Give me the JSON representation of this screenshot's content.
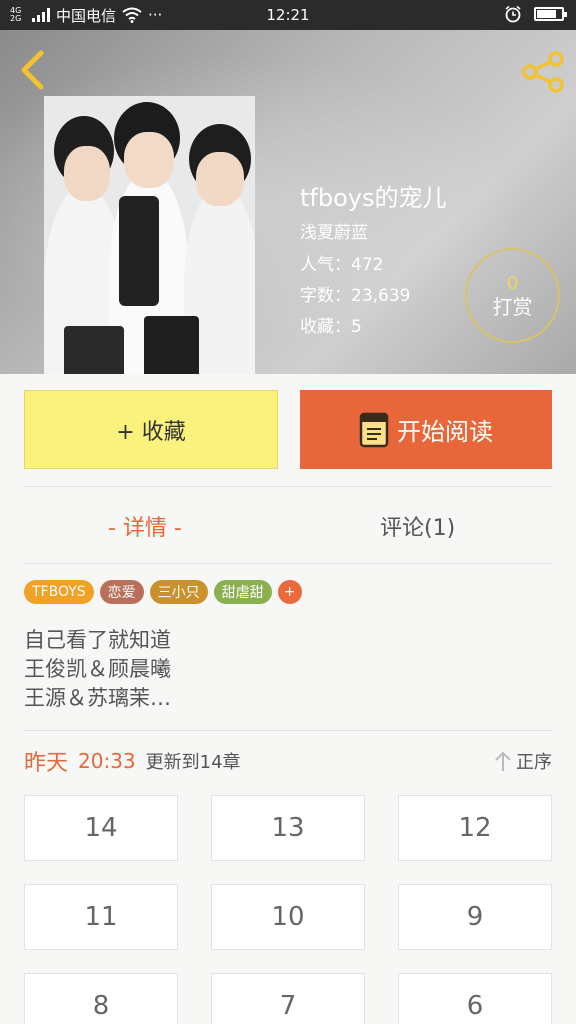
{
  "status_bar": {
    "network": "4G 2G",
    "carrier": "中国电信",
    "more": "···",
    "time": "12:21",
    "battery_level": 0.8
  },
  "book": {
    "title": "tfboys的宠儿",
    "author": "浅夏蔚蓝",
    "stats": [
      {
        "label": "人气：",
        "value": "472"
      },
      {
        "label": "字数：",
        "value": "23,639"
      },
      {
        "label": "收藏：",
        "value": "5"
      }
    ],
    "tip_count": "0",
    "tip_label": "打赏"
  },
  "actions": {
    "collect_label": "+ 收藏",
    "read_label": "开始阅读"
  },
  "tabs": {
    "detail_label": "- 详情 -",
    "comment_label": "评论(1)"
  },
  "tags": [
    {
      "label": "TFBOYS",
      "color": "#f0a126"
    },
    {
      "label": "恋爱",
      "color": "#b8705a"
    },
    {
      "label": "三小只",
      "color": "#c9922f"
    },
    {
      "label": "甜虐甜",
      "color": "#8bb04f"
    },
    {
      "label": "+",
      "color": "#ea6a3c"
    }
  ],
  "description": {
    "line1": "自己看了就知道",
    "line2": "王俊凯＆顾晨曦",
    "line3": "王源＆苏璃茉…"
  },
  "update": {
    "day": "昨天",
    "time": "20:33",
    "text": "更新到14章",
    "order_label": "正序"
  },
  "chapters": [
    "14",
    "13",
    "12",
    "11",
    "10",
    "9",
    "8",
    "7",
    "6"
  ],
  "colors": {
    "accent": "#e7673a",
    "collect_bg": "#fbf27d",
    "tip_ring": "#d9c26a"
  }
}
